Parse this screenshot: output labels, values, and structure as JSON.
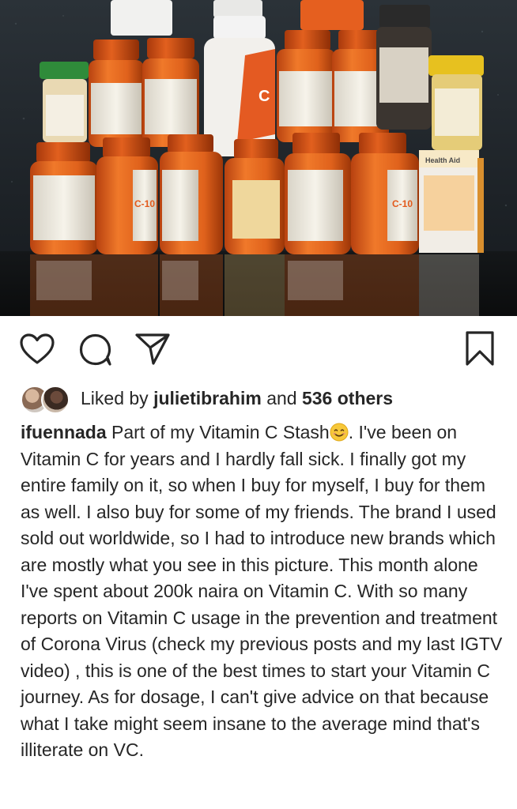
{
  "post": {
    "photo_subject": "vitamin-c-bottles-photo",
    "actions": {
      "like_icon": "heart-icon",
      "comment_icon": "comment-bubble-icon",
      "share_icon": "paper-plane-icon",
      "save_icon": "bookmark-icon"
    },
    "likes": {
      "prefix": "Liked by ",
      "user": "julietibrahim",
      "middle": " and ",
      "others": "536 others"
    },
    "caption": {
      "username": "ifuennada",
      "text_before_emoji": " Part of my Vitamin C Stash",
      "emoji": "smiling-face-emoji",
      "text_after_emoji": ". I've been on Vitamin C for years and I hardly fall sick. I finally got my entire family on it, so when I buy for myself, I buy for them as well. I also buy for some of my friends. The brand I used sold out worldwide, so I had to introduce new brands which are mostly what you see in this picture. This month alone I've spent about 200k naira on Vitamin C. With so many reports on Vitamin C usage in the prevention and treatment of Corona Virus (check my previous posts and my last IGTV video) , this is one of the best times to start your Vitamin C journey. As for dosage, I can't give advice on that because what I take might seem insane to the average mind that's illiterate on VC."
    }
  },
  "colors": {
    "text": "#262626",
    "bottle_orange": "#e8661c",
    "cap_orange": "#d9531a",
    "background_dark": "#1a1f24"
  }
}
